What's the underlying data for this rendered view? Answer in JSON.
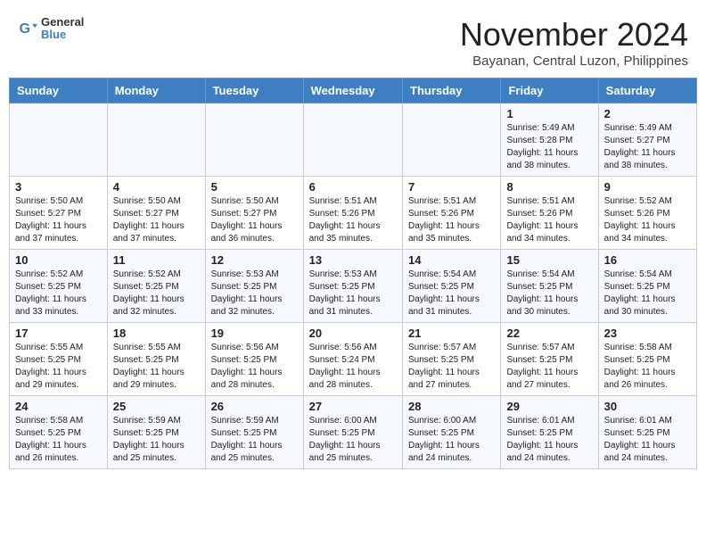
{
  "header": {
    "logo_line1": "General",
    "logo_line2": "Blue",
    "month_year": "November 2024",
    "location": "Bayanan, Central Luzon, Philippines"
  },
  "weekdays": [
    "Sunday",
    "Monday",
    "Tuesday",
    "Wednesday",
    "Thursday",
    "Friday",
    "Saturday"
  ],
  "weeks": [
    [
      {
        "day": "",
        "info": ""
      },
      {
        "day": "",
        "info": ""
      },
      {
        "day": "",
        "info": ""
      },
      {
        "day": "",
        "info": ""
      },
      {
        "day": "",
        "info": ""
      },
      {
        "day": "1",
        "info": "Sunrise: 5:49 AM\nSunset: 5:28 PM\nDaylight: 11 hours and 38 minutes."
      },
      {
        "day": "2",
        "info": "Sunrise: 5:49 AM\nSunset: 5:27 PM\nDaylight: 11 hours and 38 minutes."
      }
    ],
    [
      {
        "day": "3",
        "info": "Sunrise: 5:50 AM\nSunset: 5:27 PM\nDaylight: 11 hours and 37 minutes."
      },
      {
        "day": "4",
        "info": "Sunrise: 5:50 AM\nSunset: 5:27 PM\nDaylight: 11 hours and 37 minutes."
      },
      {
        "day": "5",
        "info": "Sunrise: 5:50 AM\nSunset: 5:27 PM\nDaylight: 11 hours and 36 minutes."
      },
      {
        "day": "6",
        "info": "Sunrise: 5:51 AM\nSunset: 5:26 PM\nDaylight: 11 hours and 35 minutes."
      },
      {
        "day": "7",
        "info": "Sunrise: 5:51 AM\nSunset: 5:26 PM\nDaylight: 11 hours and 35 minutes."
      },
      {
        "day": "8",
        "info": "Sunrise: 5:51 AM\nSunset: 5:26 PM\nDaylight: 11 hours and 34 minutes."
      },
      {
        "day": "9",
        "info": "Sunrise: 5:52 AM\nSunset: 5:26 PM\nDaylight: 11 hours and 34 minutes."
      }
    ],
    [
      {
        "day": "10",
        "info": "Sunrise: 5:52 AM\nSunset: 5:25 PM\nDaylight: 11 hours and 33 minutes."
      },
      {
        "day": "11",
        "info": "Sunrise: 5:52 AM\nSunset: 5:25 PM\nDaylight: 11 hours and 32 minutes."
      },
      {
        "day": "12",
        "info": "Sunrise: 5:53 AM\nSunset: 5:25 PM\nDaylight: 11 hours and 32 minutes."
      },
      {
        "day": "13",
        "info": "Sunrise: 5:53 AM\nSunset: 5:25 PM\nDaylight: 11 hours and 31 minutes."
      },
      {
        "day": "14",
        "info": "Sunrise: 5:54 AM\nSunset: 5:25 PM\nDaylight: 11 hours and 31 minutes."
      },
      {
        "day": "15",
        "info": "Sunrise: 5:54 AM\nSunset: 5:25 PM\nDaylight: 11 hours and 30 minutes."
      },
      {
        "day": "16",
        "info": "Sunrise: 5:54 AM\nSunset: 5:25 PM\nDaylight: 11 hours and 30 minutes."
      }
    ],
    [
      {
        "day": "17",
        "info": "Sunrise: 5:55 AM\nSunset: 5:25 PM\nDaylight: 11 hours and 29 minutes."
      },
      {
        "day": "18",
        "info": "Sunrise: 5:55 AM\nSunset: 5:25 PM\nDaylight: 11 hours and 29 minutes."
      },
      {
        "day": "19",
        "info": "Sunrise: 5:56 AM\nSunset: 5:25 PM\nDaylight: 11 hours and 28 minutes."
      },
      {
        "day": "20",
        "info": "Sunrise: 5:56 AM\nSunset: 5:24 PM\nDaylight: 11 hours and 28 minutes."
      },
      {
        "day": "21",
        "info": "Sunrise: 5:57 AM\nSunset: 5:25 PM\nDaylight: 11 hours and 27 minutes."
      },
      {
        "day": "22",
        "info": "Sunrise: 5:57 AM\nSunset: 5:25 PM\nDaylight: 11 hours and 27 minutes."
      },
      {
        "day": "23",
        "info": "Sunrise: 5:58 AM\nSunset: 5:25 PM\nDaylight: 11 hours and 26 minutes."
      }
    ],
    [
      {
        "day": "24",
        "info": "Sunrise: 5:58 AM\nSunset: 5:25 PM\nDaylight: 11 hours and 26 minutes."
      },
      {
        "day": "25",
        "info": "Sunrise: 5:59 AM\nSunset: 5:25 PM\nDaylight: 11 hours and 25 minutes."
      },
      {
        "day": "26",
        "info": "Sunrise: 5:59 AM\nSunset: 5:25 PM\nDaylight: 11 hours and 25 minutes."
      },
      {
        "day": "27",
        "info": "Sunrise: 6:00 AM\nSunset: 5:25 PM\nDaylight: 11 hours and 25 minutes."
      },
      {
        "day": "28",
        "info": "Sunrise: 6:00 AM\nSunset: 5:25 PM\nDaylight: 11 hours and 24 minutes."
      },
      {
        "day": "29",
        "info": "Sunrise: 6:01 AM\nSunset: 5:25 PM\nDaylight: 11 hours and 24 minutes."
      },
      {
        "day": "30",
        "info": "Sunrise: 6:01 AM\nSunset: 5:25 PM\nDaylight: 11 hours and 24 minutes."
      }
    ]
  ]
}
